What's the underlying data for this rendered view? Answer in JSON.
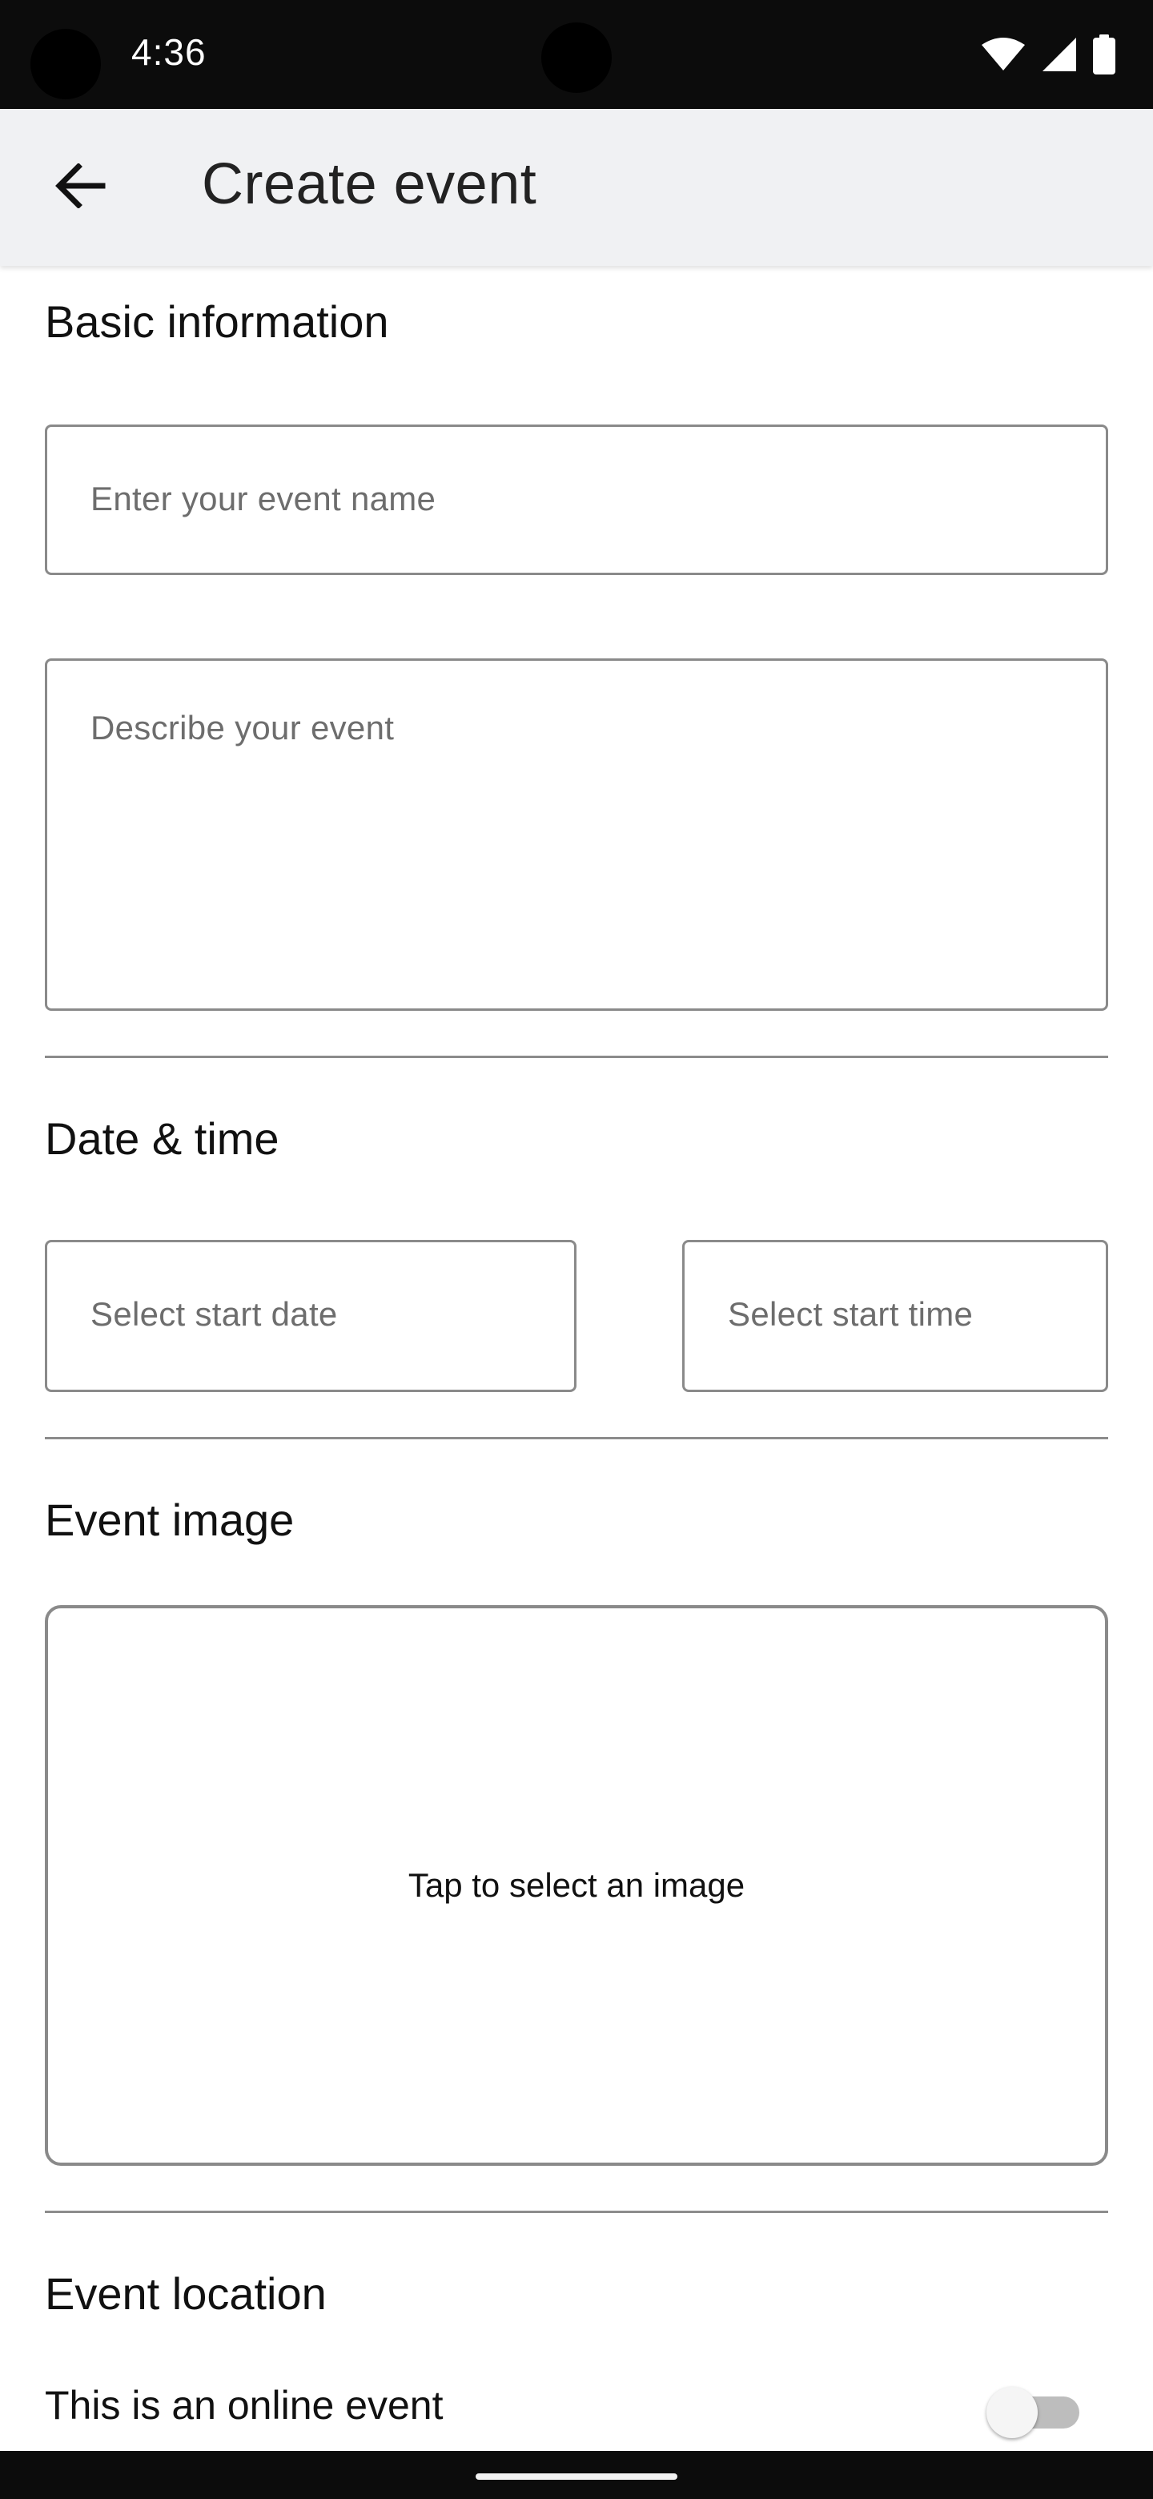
{
  "status_bar": {
    "time": "4:36",
    "icons": [
      "wifi-icon",
      "cellular-signal-icon",
      "battery-icon"
    ]
  },
  "app_bar": {
    "back_icon": "arrow-left-icon",
    "title": "Create event"
  },
  "basic_information": {
    "title": "Basic information",
    "event_name_placeholder": "Enter your event name",
    "event_description_placeholder": "Describe your event"
  },
  "date_time": {
    "title": "Date & time",
    "start_date_placeholder": "Select start date",
    "start_time_placeholder": "Select start time"
  },
  "event_image": {
    "title": "Event image",
    "picker_label": "Tap to select an image"
  },
  "event_location": {
    "title": "Event location",
    "online_label": "This is an online event",
    "online_toggle_on": false
  },
  "colors": {
    "status_bar": "#0c0c0c",
    "app_bar": "#f0f1f3",
    "field_border": "#8a8a8a",
    "placeholder_text": "#6d6d6d",
    "toggle_track_off": "#bdbdbd"
  }
}
